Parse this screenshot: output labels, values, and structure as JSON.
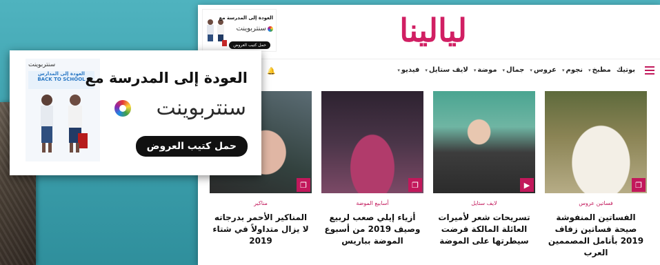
{
  "site": {
    "logo": "ليالينا",
    "mini_ad": {
      "headline": "العودة إلى المدرسة مع",
      "brand": "سنتربوينت",
      "cta": "حمل كتيب العروض"
    },
    "nav": {
      "items": [
        "فيديو",
        "لايف ستايل",
        "موضة",
        "جمال",
        "عروس",
        "نجوم",
        "مطبخ",
        "بوتيك"
      ]
    },
    "cards": [
      {
        "category": "فساتين عروس",
        "title": "الفساتين المنفوشة صيحة فساتين زفاف 2019 بأنامل المصممين العرب"
      },
      {
        "category": "لايف ستايل",
        "title": "تسريحات شعر لأميرات العائلة المالكة فرضت سيطرتها على الموضة"
      },
      {
        "category": "أسابيع الموضة",
        "title": "أزياء إيلي صعب لربيع وصيف 2019 من أسبوع الموضة بباريس"
      },
      {
        "category": "مناكير",
        "title": "المناكير الأحمر بدرجاته لا يزال متداولاً في شتاء 2019"
      }
    ]
  },
  "ad": {
    "headline": "العودة إلى المدرسة مع",
    "brand": "سنتربوينت",
    "cta": "حمل كتيب العروض",
    "poster_brand": "سنتربوينت",
    "poster_subtitle": "العودة إلى المدارس",
    "poster_tag": "BACK TO SCHOOL"
  },
  "colors": {
    "brand_pink": "#d11f63",
    "accent": "#c2185b",
    "background_teal": "#3c9fac"
  }
}
